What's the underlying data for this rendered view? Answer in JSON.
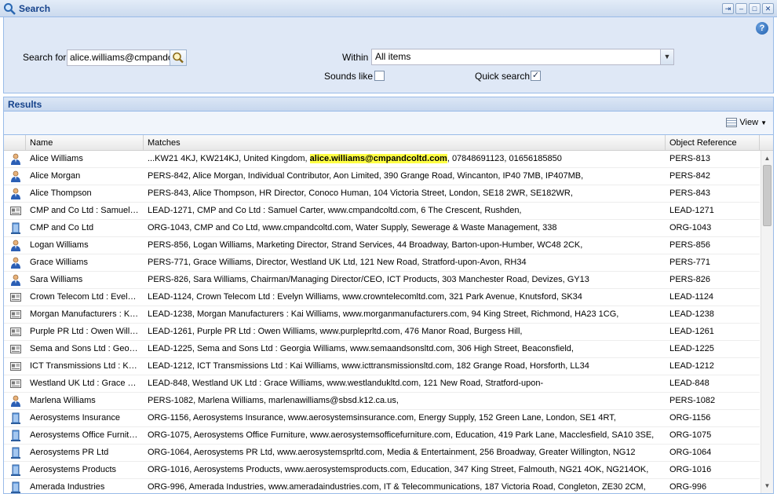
{
  "window": {
    "title": "Search",
    "buttons": [
      "⇥",
      "–",
      "□",
      "✕"
    ]
  },
  "form": {
    "search_label": "Search for",
    "search_value": "alice.williams@cmpandcoltd.com",
    "within_label": "Within",
    "within_value": "All items",
    "sounds_like_label": "Sounds like",
    "sounds_like_checked": false,
    "quick_search_label": "Quick search",
    "quick_search_checked": true,
    "help_glyph": "?"
  },
  "results": {
    "title": "Results",
    "view_label": "View",
    "columns": {
      "name": "Name",
      "matches": "Matches",
      "ref": "Object Reference"
    },
    "rows": [
      {
        "icon": "person",
        "name": "Alice Williams",
        "pre": "...KW21 4KJ, KW214KJ, United Kingdom, ",
        "hl": "alice.williams@cmpandcoltd.com",
        "post": ", 07848691123, 01656185850",
        "ref": "PERS-813"
      },
      {
        "icon": "person",
        "name": "Alice Morgan",
        "pre": "PERS-842, Alice Morgan, Individual Contributor, Aon Limited, 390 Grange Road, Wincanton, IP40 7MB, IP407MB,",
        "hl": "",
        "post": "",
        "ref": "PERS-842"
      },
      {
        "icon": "person",
        "name": "Alice Thompson",
        "pre": "PERS-843, Alice Thompson, HR Director, Conoco Human, 104 Victoria Street, London, SE18 2WR, SE182WR,",
        "hl": "",
        "post": "",
        "ref": "PERS-843"
      },
      {
        "icon": "lead",
        "name": "CMP and Co Ltd : Samuel Carter",
        "pre": "LEAD-1271, CMP and Co Ltd : Samuel Carter, www.cmpandcoltd.com, 6 The Crescent, Rushden,",
        "hl": "",
        "post": "",
        "ref": "LEAD-1271"
      },
      {
        "icon": "org",
        "name": "CMP and Co Ltd",
        "pre": "ORG-1043, CMP and Co Ltd, www.cmpandcoltd.com, Water Supply, Sewerage & Waste Management, 338",
        "hl": "",
        "post": "",
        "ref": "ORG-1043"
      },
      {
        "icon": "person",
        "name": "Logan Williams",
        "pre": "PERS-856, Logan Williams, Marketing Director, Strand Services, 44 Broadway, Barton-upon-Humber, WC48 2CK,",
        "hl": "",
        "post": "",
        "ref": "PERS-856"
      },
      {
        "icon": "person",
        "name": "Grace Williams",
        "pre": "PERS-771, Grace Williams, Director, Westland UK Ltd, 121 New Road, Stratford-upon-Avon, RH34",
        "hl": "",
        "post": "",
        "ref": "PERS-771"
      },
      {
        "icon": "person",
        "name": "Sara Williams",
        "pre": "PERS-826, Sara Williams, Chairman/Managing Director/CEO, ICT Products, 303 Manchester Road, Devizes, GY13",
        "hl": "",
        "post": "",
        "ref": "PERS-826"
      },
      {
        "icon": "lead",
        "name": "Crown Telecom Ltd : Evelyn Williams",
        "pre": "LEAD-1124, Crown Telecom Ltd : Evelyn Williams, www.crowntelecomltd.com, 321 Park Avenue, Knutsford, SK34",
        "hl": "",
        "post": "",
        "ref": "LEAD-1124"
      },
      {
        "icon": "lead",
        "name": "Morgan Manufacturers : Kai Williams",
        "pre": "LEAD-1238, Morgan Manufacturers : Kai Williams, www.morganmanufacturers.com, 94 King Street, Richmond, HA23 1CG,",
        "hl": "",
        "post": "",
        "ref": "LEAD-1238"
      },
      {
        "icon": "lead",
        "name": "Purple PR Ltd : Owen Williams",
        "pre": "LEAD-1261, Purple PR Ltd : Owen Williams, www.purpleprltd.com, 476 Manor Road, Burgess Hill,",
        "hl": "",
        "post": "",
        "ref": "LEAD-1261"
      },
      {
        "icon": "lead",
        "name": "Sema and Sons Ltd : Georgia Williams",
        "pre": "LEAD-1225, Sema and Sons Ltd : Georgia Williams, www.semaandsonsltd.com, 306 High Street, Beaconsfield,",
        "hl": "",
        "post": "",
        "ref": "LEAD-1225"
      },
      {
        "icon": "lead",
        "name": "ICT Transmissions Ltd : Kai Williams",
        "pre": "LEAD-1212, ICT Transmissions Ltd : Kai Williams, www.icttransmissionsltd.com, 182 Grange Road, Horsforth, LL34",
        "hl": "",
        "post": "",
        "ref": "LEAD-1212"
      },
      {
        "icon": "lead",
        "name": "Westland UK Ltd : Grace Williams",
        "pre": "LEAD-848, Westland UK Ltd : Grace Williams, www.westlandukltd.com, 121 New Road, Stratford-upon-",
        "hl": "",
        "post": "",
        "ref": "LEAD-848"
      },
      {
        "icon": "person",
        "name": "Marlena Williams",
        "pre": "PERS-1082, Marlena Williams, marlenawilliams@sbsd.k12.ca.us,",
        "hl": "",
        "post": "",
        "ref": "PERS-1082"
      },
      {
        "icon": "org",
        "name": "Aerosystems Insurance",
        "pre": "ORG-1156, Aerosystems Insurance, www.aerosystemsinsurance.com, Energy Supply, 152 Green Lane, London, SE1 4RT,",
        "hl": "",
        "post": "",
        "ref": "ORG-1156"
      },
      {
        "icon": "org",
        "name": "Aerosystems Office Furniture",
        "pre": "ORG-1075, Aerosystems Office Furniture, www.aerosystemsofficefurniture.com, Education, 419 Park Lane, Macclesfield, SA10 3SE,",
        "hl": "",
        "post": "",
        "ref": "ORG-1075"
      },
      {
        "icon": "org",
        "name": "Aerosystems PR Ltd",
        "pre": "ORG-1064, Aerosystems PR Ltd, www.aerosystemsprltd.com, Media & Entertainment, 256 Broadway, Greater Willington, NG12",
        "hl": "",
        "post": "",
        "ref": "ORG-1064"
      },
      {
        "icon": "org",
        "name": "Aerosystems Products",
        "pre": "ORG-1016, Aerosystems Products, www.aerosystemsproducts.com, Education, 347 King Street, Falmouth, NG21 4OK, NG214OK,",
        "hl": "",
        "post": "",
        "ref": "ORG-1016"
      },
      {
        "icon": "org",
        "name": "Amerada Industries",
        "pre": "ORG-996, Amerada Industries, www.ameradaindustries.com, IT & Telecommunications, 187 Victoria Road, Congleton, ZE30 2CM,",
        "hl": "",
        "post": "",
        "ref": "ORG-996"
      }
    ]
  }
}
